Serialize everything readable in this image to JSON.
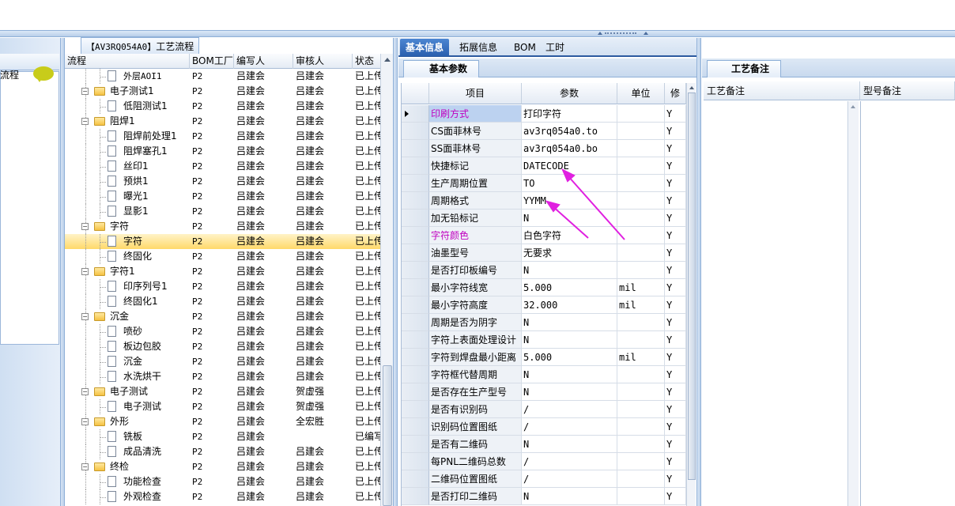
{
  "process": {
    "title_code": "【AV3RQ054A0】",
    "title_text": "工艺流程",
    "nav_label": "流程",
    "columns": [
      "流程",
      "BOM工厂",
      "编写人",
      "审核人",
      "状态"
    ],
    "rows": [
      {
        "level": 2,
        "type": "doc",
        "name": "外层AOI1",
        "bom": "P2",
        "writer": "吕建会",
        "reviewer": "吕建会",
        "status": "已上传",
        "mono": true
      },
      {
        "level": 1,
        "type": "folder",
        "name": "电子测试1",
        "bom": "P2",
        "writer": "吕建会",
        "reviewer": "吕建会",
        "status": "已上传"
      },
      {
        "level": 2,
        "type": "doc",
        "name": "低阻测试1",
        "bom": "P2",
        "writer": "吕建会",
        "reviewer": "吕建会",
        "status": "已上传"
      },
      {
        "level": 1,
        "type": "folder",
        "name": "阻焊1",
        "bom": "P2",
        "writer": "吕建会",
        "reviewer": "吕建会",
        "status": "已上传"
      },
      {
        "level": 2,
        "type": "doc",
        "name": "阻焊前处理1",
        "bom": "P2",
        "writer": "吕建会",
        "reviewer": "吕建会",
        "status": "已上传"
      },
      {
        "level": 2,
        "type": "doc",
        "name": "阻焊塞孔1",
        "bom": "P2",
        "writer": "吕建会",
        "reviewer": "吕建会",
        "status": "已上传"
      },
      {
        "level": 2,
        "type": "doc",
        "name": "丝印1",
        "bom": "P2",
        "writer": "吕建会",
        "reviewer": "吕建会",
        "status": "已上传"
      },
      {
        "level": 2,
        "type": "doc",
        "name": "预烘1",
        "bom": "P2",
        "writer": "吕建会",
        "reviewer": "吕建会",
        "status": "已上传"
      },
      {
        "level": 2,
        "type": "doc",
        "name": "曝光1",
        "bom": "P2",
        "writer": "吕建会",
        "reviewer": "吕建会",
        "status": "已上传"
      },
      {
        "level": 2,
        "type": "doc",
        "name": "显影1",
        "bom": "P2",
        "writer": "吕建会",
        "reviewer": "吕建会",
        "status": "已上传"
      },
      {
        "level": 1,
        "type": "folder",
        "name": "字符",
        "bom": "P2",
        "writer": "吕建会",
        "reviewer": "吕建会",
        "status": "已上传"
      },
      {
        "level": 2,
        "type": "doc",
        "name": "字符",
        "bom": "P2",
        "writer": "吕建会",
        "reviewer": "吕建会",
        "status": "已上传",
        "selected": true
      },
      {
        "level": 2,
        "type": "doc",
        "name": "终固化",
        "bom": "P2",
        "writer": "吕建会",
        "reviewer": "吕建会",
        "status": "已上传"
      },
      {
        "level": 1,
        "type": "folder",
        "name": "字符1",
        "bom": "P2",
        "writer": "吕建会",
        "reviewer": "吕建会",
        "status": "已上传"
      },
      {
        "level": 2,
        "type": "doc",
        "name": "印序列号1",
        "bom": "P2",
        "writer": "吕建会",
        "reviewer": "吕建会",
        "status": "已上传"
      },
      {
        "level": 2,
        "type": "doc",
        "name": "终固化1",
        "bom": "P2",
        "writer": "吕建会",
        "reviewer": "吕建会",
        "status": "已上传"
      },
      {
        "level": 1,
        "type": "folder",
        "name": "沉金",
        "bom": "P2",
        "writer": "吕建会",
        "reviewer": "吕建会",
        "status": "已上传"
      },
      {
        "level": 2,
        "type": "doc",
        "name": "喷砂",
        "bom": "P2",
        "writer": "吕建会",
        "reviewer": "吕建会",
        "status": "已上传"
      },
      {
        "level": 2,
        "type": "doc",
        "name": "板边包胶",
        "bom": "P2",
        "writer": "吕建会",
        "reviewer": "吕建会",
        "status": "已上传"
      },
      {
        "level": 2,
        "type": "doc",
        "name": "沉金",
        "bom": "P2",
        "writer": "吕建会",
        "reviewer": "吕建会",
        "status": "已上传"
      },
      {
        "level": 2,
        "type": "doc",
        "name": "水洗烘干",
        "bom": "P2",
        "writer": "吕建会",
        "reviewer": "吕建会",
        "status": "已上传"
      },
      {
        "level": 1,
        "type": "folder",
        "name": "电子测试",
        "bom": "P2",
        "writer": "吕建会",
        "reviewer": "贺虚强",
        "status": "已上传"
      },
      {
        "level": 2,
        "type": "doc",
        "name": "电子测试",
        "bom": "P2",
        "writer": "吕建会",
        "reviewer": "贺虚强",
        "status": "已上传"
      },
      {
        "level": 1,
        "type": "folder",
        "name": "外形",
        "bom": "P2",
        "writer": "吕建会",
        "reviewer": "全宏胜",
        "status": "已上传"
      },
      {
        "level": 2,
        "type": "doc",
        "name": "铣板",
        "bom": "P2",
        "writer": "吕建会",
        "reviewer": "",
        "status": "已编写"
      },
      {
        "level": 2,
        "type": "doc",
        "name": "成品清洗",
        "bom": "P2",
        "writer": "吕建会",
        "reviewer": "吕建会",
        "status": "已上传"
      },
      {
        "level": 1,
        "type": "folder",
        "name": "终检",
        "bom": "P2",
        "writer": "吕建会",
        "reviewer": "吕建会",
        "status": "已上传"
      },
      {
        "level": 2,
        "type": "doc",
        "name": "功能检查",
        "bom": "P2",
        "writer": "吕建会",
        "reviewer": "吕建会",
        "status": "已上传"
      },
      {
        "level": 2,
        "type": "doc",
        "name": "外观检查",
        "bom": "P2",
        "writer": "吕建会",
        "reviewer": "吕建会",
        "status": "已上传"
      }
    ]
  },
  "middle": {
    "tabs": [
      "基本信息",
      "拓展信息",
      "BOM",
      "工时"
    ],
    "active_tab": 0,
    "subtab": "基本参数",
    "grid_columns": [
      "项目",
      "参数",
      "单位",
      "修"
    ],
    "rows": [
      {
        "item": "印刷方式",
        "param": "打印字符",
        "unit": "",
        "flag": "Y",
        "pink": true,
        "current": true
      },
      {
        "item": "CS面菲林号",
        "param": "av3rq054a0.to",
        "unit": "",
        "flag": "Y",
        "mono": true
      },
      {
        "item": "SS面菲林号",
        "param": "av3rq054a0.bo",
        "unit": "",
        "flag": "Y",
        "mono": true
      },
      {
        "item": "快捷标记",
        "param": "DATECODE",
        "unit": "",
        "flag": "Y",
        "mono": true
      },
      {
        "item": "生产周期位置",
        "param": "TO",
        "unit": "",
        "flag": "Y",
        "mono": true
      },
      {
        "item": "周期格式",
        "param": "YYMM",
        "unit": "",
        "flag": "Y",
        "mono": true
      },
      {
        "item": "加无铅标记",
        "param": "N",
        "unit": "",
        "flag": "Y",
        "mono": true
      },
      {
        "item": "字符颜色",
        "param": "白色字符",
        "unit": "",
        "flag": "Y",
        "pink": true
      },
      {
        "item": "油墨型号",
        "param": "无要求",
        "unit": "",
        "flag": "Y"
      },
      {
        "item": "是否打印板编号",
        "param": "N",
        "unit": "",
        "flag": "Y",
        "mono": true
      },
      {
        "item": "最小字符线宽",
        "param": "5.000",
        "unit": "mil",
        "flag": "Y",
        "mono": true
      },
      {
        "item": "最小字符高度",
        "param": "32.000",
        "unit": "mil",
        "flag": "Y",
        "mono": true
      },
      {
        "item": "周期是否为阴字",
        "param": "N",
        "unit": "",
        "flag": "Y",
        "mono": true
      },
      {
        "item": "字符上表面处理设计",
        "param": "N",
        "unit": "",
        "flag": "Y",
        "mono": true
      },
      {
        "item": "字符到焊盘最小距离",
        "param": "5.000",
        "unit": "mil",
        "flag": "Y",
        "mono": true
      },
      {
        "item": "字符框代替周期",
        "param": "N",
        "unit": "",
        "flag": "Y",
        "mono": true
      },
      {
        "item": "是否存在生产型号",
        "param": "N",
        "unit": "",
        "flag": "Y",
        "mono": true
      },
      {
        "item": "是否有识别码",
        "param": "/",
        "unit": "",
        "flag": "Y",
        "mono": true
      },
      {
        "item": "识别码位置图纸",
        "param": "/",
        "unit": "",
        "flag": "Y",
        "mono": true
      },
      {
        "item": "是否有二维码",
        "param": "N",
        "unit": "",
        "flag": "Y",
        "mono": true
      },
      {
        "item": "每PNL二维码总数",
        "param": "/",
        "unit": "",
        "flag": "Y",
        "mono": true
      },
      {
        "item": "二维码位置图纸",
        "param": "/",
        "unit": "",
        "flag": "Y",
        "mono": true
      },
      {
        "item": "是否打印二维码",
        "param": "N",
        "unit": "",
        "flag": "Y",
        "mono": true
      }
    ]
  },
  "right": {
    "tab": "工艺备注",
    "columns": [
      "工艺备注",
      "型号备注"
    ]
  },
  "colors": {
    "arrow": "#e020e0",
    "pink_text": "#c000c0",
    "tab_active": "#2a5fae",
    "selection": "#ffd96a"
  },
  "icons": [
    "folder-icon",
    "document-icon",
    "chat-bubble-icon",
    "row-pointer-icon",
    "scroll-up-icon",
    "annotation-arrow"
  ]
}
